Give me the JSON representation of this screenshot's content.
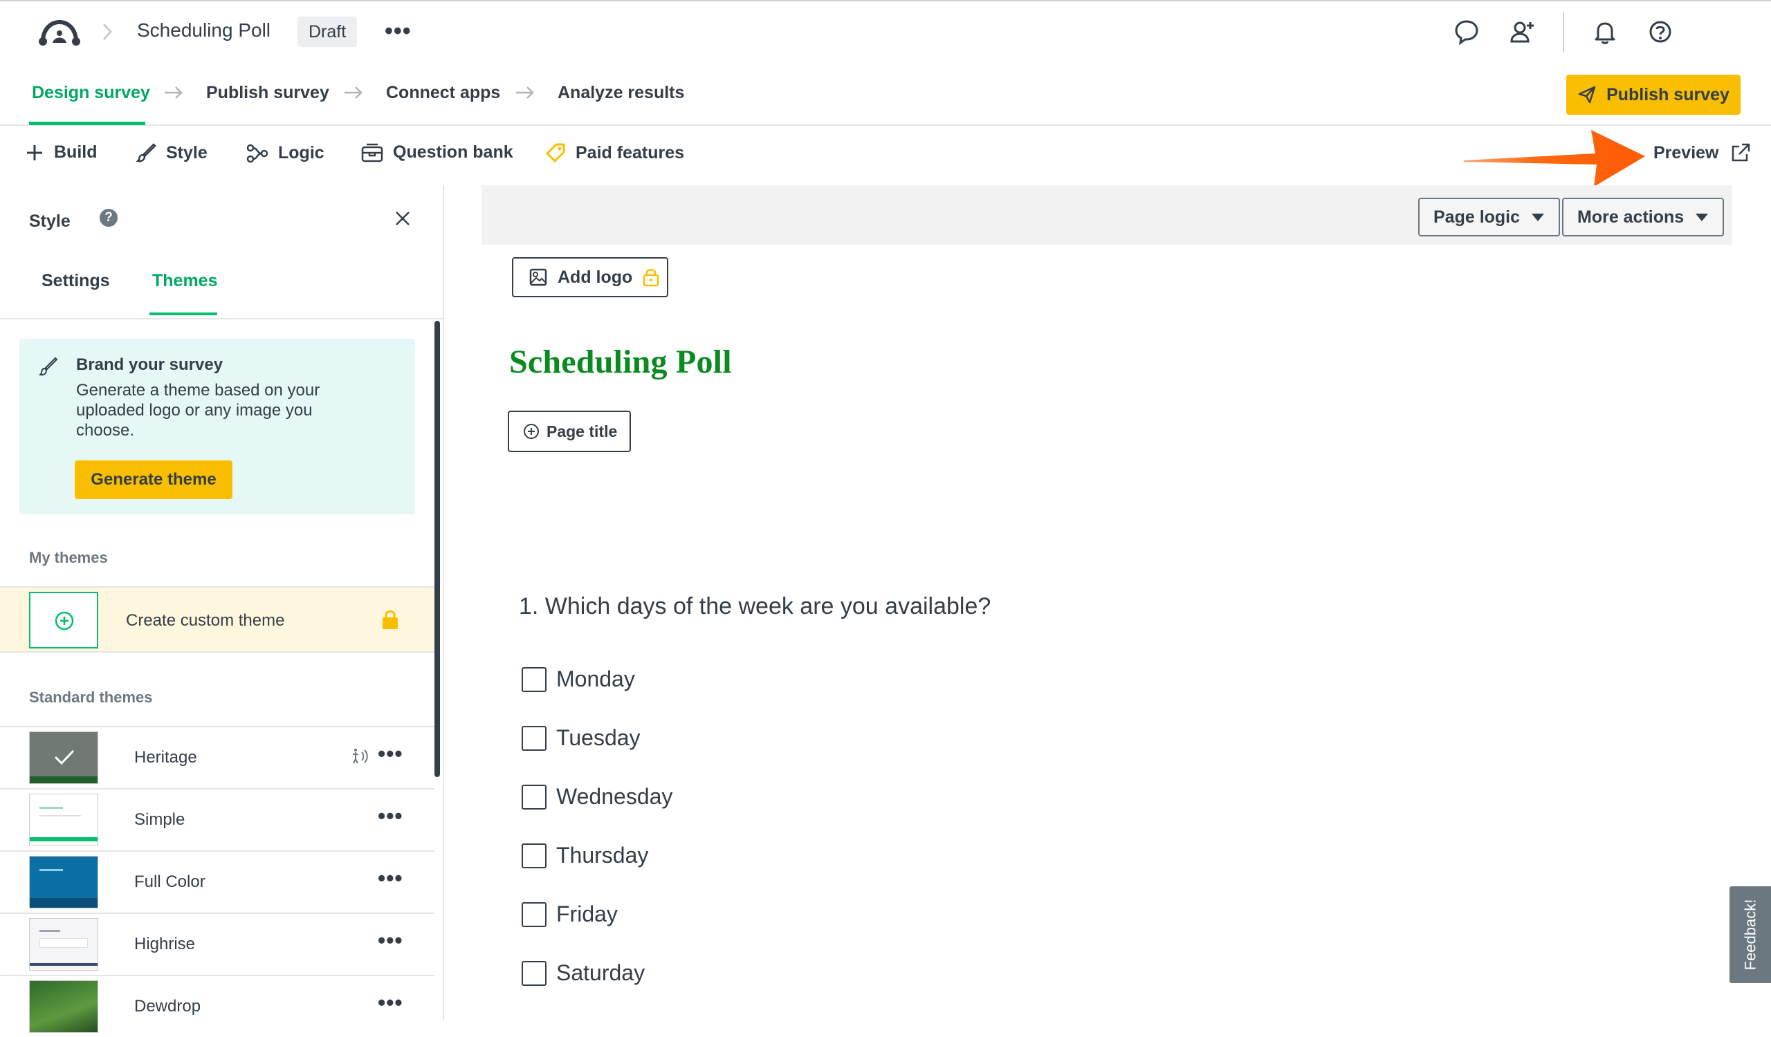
{
  "header": {
    "survey_title": "Scheduling Poll",
    "status_badge": "Draft",
    "more_label": "•••"
  },
  "steps": [
    {
      "label": "Design survey",
      "active": true
    },
    {
      "label": "Publish survey",
      "active": false
    },
    {
      "label": "Connect apps",
      "active": false
    },
    {
      "label": "Analyze results",
      "active": false
    }
  ],
  "publish_button": "Publish survey",
  "toolbar": {
    "build": "Build",
    "style": "Style",
    "logic": "Logic",
    "question_bank": "Question bank",
    "paid_features": "Paid features",
    "preview": "Preview"
  },
  "style_panel": {
    "title": "Style",
    "help": "?",
    "tabs": [
      "Settings",
      "Themes"
    ],
    "active_tab": "Themes",
    "brand_card": {
      "title": "Brand your survey",
      "description": "Generate a theme based on your uploaded logo or any image you choose.",
      "button": "Generate theme"
    },
    "my_themes_label": "My themes",
    "create_custom": "Create custom theme",
    "standard_themes_label": "Standard themes",
    "themes": [
      {
        "name": "Heritage",
        "selected": true
      },
      {
        "name": "Simple",
        "selected": false
      },
      {
        "name": "Full Color",
        "selected": false
      },
      {
        "name": "Highrise",
        "selected": false
      },
      {
        "name": "Dewdrop",
        "selected": false
      }
    ],
    "theme_menu": "•••"
  },
  "canvas": {
    "page_logic": "Page logic",
    "more_actions": "More actions",
    "add_logo": "Add logo",
    "survey_heading": "Scheduling Poll",
    "page_title_button": "Page title",
    "question": "1. Which days of the week are you available?",
    "options": [
      "Monday",
      "Tuesday",
      "Wednesday",
      "Thursday",
      "Friday",
      "Saturday"
    ]
  },
  "feedback": "Feedback!",
  "colors": {
    "brand_green": "#00bf6f",
    "heading_green": "#0a8a1f",
    "primary_yellow": "#f9be00",
    "annotation_orange": "#ff6a13",
    "text_dark": "#333e48"
  }
}
